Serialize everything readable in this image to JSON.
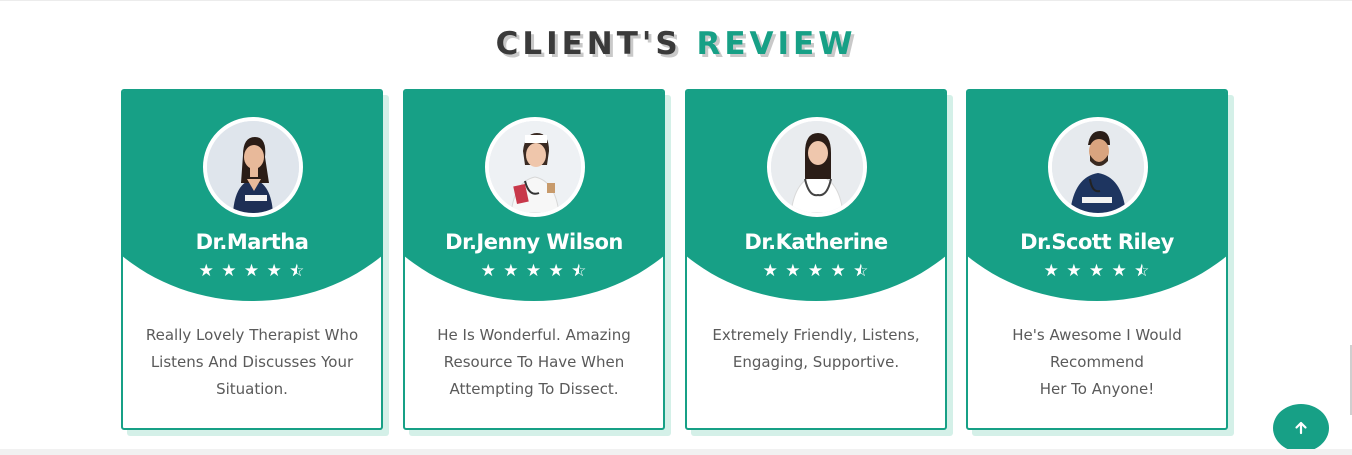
{
  "section": {
    "title_part1": "CLIENT'S",
    "title_part2": "REVIEW"
  },
  "colors": {
    "accent": "#17a086",
    "title_dark": "#3a3a3a",
    "text": "#5a5a5a"
  },
  "reviews": [
    {
      "name": "Dr.Martha",
      "rating": 4.5,
      "stars": [
        "star-icon",
        "star-icon",
        "star-icon",
        "star-icon",
        "star-half-icon"
      ],
      "lines": [
        "Really Lovely Therapist Who",
        "Listens And Discusses Your",
        "Situation."
      ]
    },
    {
      "name": "Dr.Jenny Wilson",
      "rating": 4.5,
      "stars": [
        "star-icon",
        "star-icon",
        "star-icon",
        "star-icon",
        "star-half-icon"
      ],
      "lines": [
        "He Is Wonderful. Amazing",
        "Resource To Have When",
        "Attempting To Dissect."
      ]
    },
    {
      "name": "Dr.Katherine",
      "rating": 4.5,
      "stars": [
        "star-icon",
        "star-icon",
        "star-icon",
        "star-icon",
        "star-half-icon"
      ],
      "lines": [
        "Extremely Friendly, Listens,",
        "Engaging, Supportive."
      ]
    },
    {
      "name": "Dr.Scott Riley",
      "rating": 4.5,
      "stars": [
        "star-icon",
        "star-icon",
        "star-icon",
        "star-icon",
        "star-half-icon"
      ],
      "lines": [
        "He's Awesome I Would",
        "Recommend",
        "Her To Anyone!"
      ]
    }
  ],
  "scroll_top": {
    "icon": "arrow-up-icon"
  }
}
